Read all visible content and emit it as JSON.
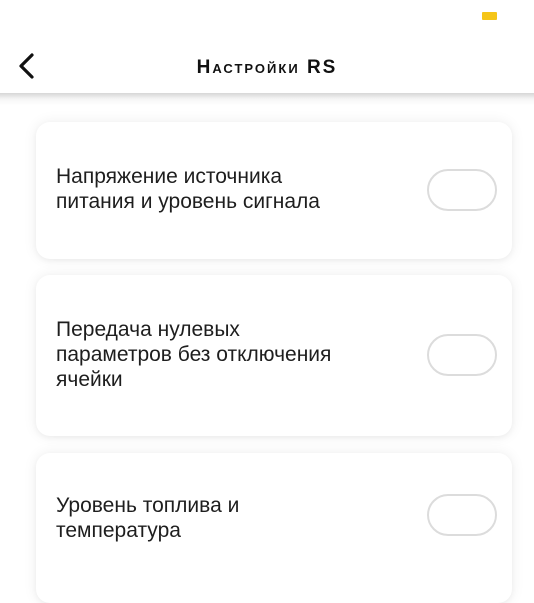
{
  "header": {
    "title": "Настройки RS"
  },
  "colors": {
    "accent": "#f5c518",
    "text": "#1e1e1e",
    "toggle_border": "#dcdcdc"
  },
  "settings": {
    "items": [
      {
        "label": "Напряжение источника\nпитания и уровень сигнала",
        "enabled": false
      },
      {
        "label": "Передача нулевых\nпараметров без отключения\nячейки",
        "enabled": false
      },
      {
        "label": "Уровень топлива и\nтемпература",
        "enabled": false
      }
    ]
  }
}
